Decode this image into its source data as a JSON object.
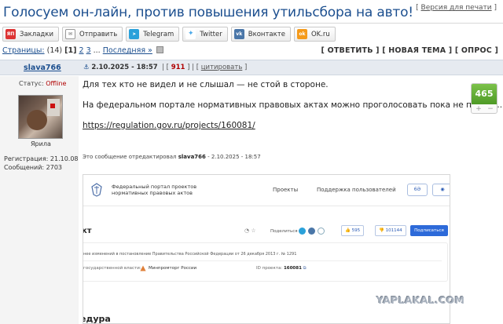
{
  "topic": {
    "title": "Голосуем он-лайн, против повышения утильсбора на авто!",
    "print_link": "Версия для печати"
  },
  "share": [
    {
      "label": "Закладки",
      "icon": "yaplakal-icon",
      "color": "#d33"
    },
    {
      "label": "Отправить",
      "icon": "mail-icon",
      "color": "#5a8"
    },
    {
      "label": "Telegram",
      "icon": "telegram-icon",
      "color": "#2aa1da"
    },
    {
      "label": "Twitter",
      "icon": "twitter-icon",
      "color": "#4aa8e8"
    },
    {
      "label": "Вконтакте",
      "icon": "vk-icon",
      "color": "#4a76a8"
    },
    {
      "label": "OK.ru",
      "icon": "ok-icon",
      "color": "#f59a1a"
    }
  ],
  "pager": {
    "prefix": "Страницы:",
    "count": "(14)",
    "current": "[1]",
    "page2": "2",
    "page3": "3",
    "ellipsis": "...",
    "last": "Последняя »"
  },
  "actions": {
    "reply": "ОТВЕТИТЬ",
    "new_topic": "НОВАЯ ТЕМА",
    "poll": "ОПРОС"
  },
  "post": {
    "author": "slava766",
    "date": "2.10.2025 - 18:57",
    "number": "911",
    "cite": "цитировать",
    "status_label": "Статус:",
    "status_value": "Offline",
    "avatar_caption": "Ярила",
    "registration": "Регистрация: 21.10.08",
    "messages": "Сообщений: 2703",
    "line1": "Для тех кто не видел и не слышал — не стой в стороне.",
    "line2": "На федеральном портале нормативных правовых актах можно проголосовать пока не поздно..",
    "link": "https://regulation.gov.ru/projects/160081/",
    "edited_prefix": "Это сообщение отредактировал",
    "edited_user": "slava766",
    "edited_date": "- 2.10.2025 - 18:57",
    "rating": "465",
    "rating_plus": "+",
    "rating_minus": "−"
  },
  "embed": {
    "logo_line1": "Федеральный портал проектов",
    "logo_line2": "нормативных правовых актов",
    "nav_projects": "Проекты",
    "nav_support": "Поддержка пользователей",
    "title": "кт",
    "share_label": "Поделиться",
    "likes": "595",
    "dislikes": "101144",
    "subscribe": "Подписаться",
    "card_line1": "нее изменений в постановление Правительства Российской Федерации от 26 декабря 2013 г. № 1291",
    "card_line2": "государственной власти:",
    "ministry": "Минпромторг России",
    "id_label": "ID проекта:",
    "id_value": "160081",
    "section": "едура"
  },
  "watermark": "YAPLAKAL.COM"
}
